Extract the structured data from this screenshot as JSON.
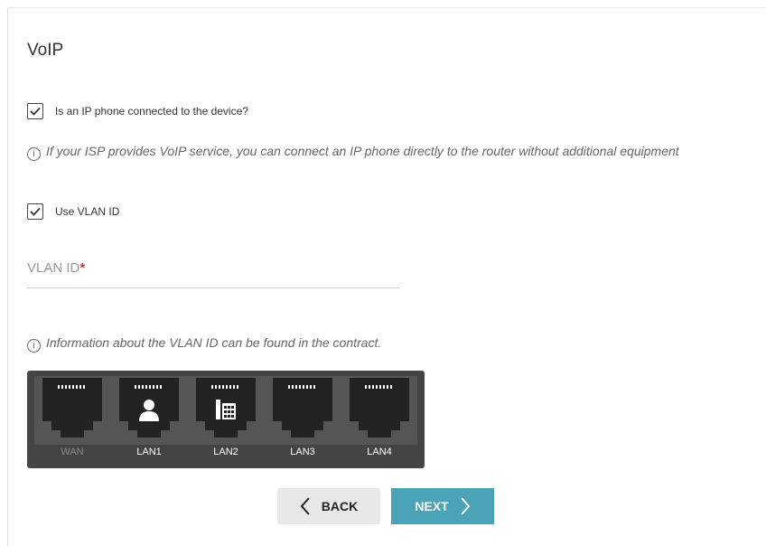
{
  "page": {
    "title": "VoIP",
    "ip_phone_checkbox": {
      "label": "Is an IP phone connected to the device?",
      "checked": true
    },
    "isp_info": "If your ISP provides VoIP service, you can connect an IP phone directly to the router without additional equipment",
    "vlan_checkbox": {
      "label": "Use VLAN ID",
      "checked": true
    },
    "vlan_field": {
      "label": "VLAN ID",
      "required_mark": "*",
      "value": ""
    },
    "vlan_info": "Information about the VLAN ID can be found in the contract.",
    "ports": [
      {
        "label": "WAN",
        "icon": "none",
        "active": false
      },
      {
        "label": "LAN1",
        "icon": "person-icon",
        "active": true
      },
      {
        "label": "LAN2",
        "icon": "phone-icon",
        "active": true
      },
      {
        "label": "LAN3",
        "icon": "none",
        "active": true
      },
      {
        "label": "LAN4",
        "icon": "none",
        "active": true
      }
    ],
    "buttons": {
      "back": "BACK",
      "next": "NEXT"
    },
    "info_icon_glyph": "i",
    "colors": {
      "next_button": "#4ba3b8",
      "back_button": "#e8e8e8",
      "port_panel": "#444444",
      "required": "#d0342c"
    }
  }
}
